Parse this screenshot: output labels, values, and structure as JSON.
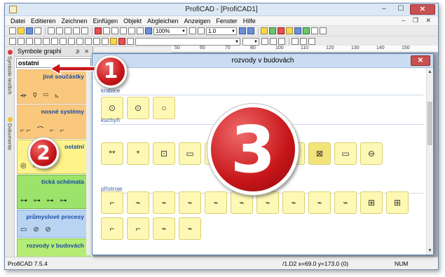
{
  "window": {
    "title": "ProfiCAD - [ProfiCAD1]",
    "controls": {
      "minimize": "–",
      "maximize": "☐",
      "close": "✕"
    }
  },
  "menu": {
    "items": [
      "Datei",
      "Editieren",
      "Zeichnen",
      "Einfügen",
      "Objekt",
      "Abgleichen",
      "Anzeigen",
      "Fenster",
      "Hilfe"
    ],
    "mdi_controls": "– ❐ ✕"
  },
  "toolbar": {
    "zoom_value": "100%",
    "line_width_value": "1.0"
  },
  "ruler": {
    "ticks": [
      "50",
      "60",
      "70",
      "80",
      "100",
      "110",
      "120",
      "130",
      "140",
      "150"
    ]
  },
  "side_tabs": [
    "Symbole textlich",
    "Dokumente"
  ],
  "symbols_panel": {
    "header": "Symbole graphi",
    "pin_controls": "⊅ ✕",
    "selected_category": "ostatní",
    "categories": [
      {
        "name": "jiné součástky",
        "symbols": "⟛ ⊽ ▭ ◺"
      },
      {
        "name": "nosné systémy",
        "symbols": "⌐⌐ ⌒ ⌐ ⌐"
      },
      {
        "name": "ostatní",
        "symbols": "◎ ▭ ⏚"
      },
      {
        "name": "tická schémata",
        "symbols": "⊶ ⊶ ⊶ ⊶"
      },
      {
        "name": "průmyslové procesy",
        "symbols": "▭ ⊘ ⊘"
      },
      {
        "name": "rozvody v budovách",
        "symbols": "⊡ ◌ ◌ ⌐"
      }
    ]
  },
  "dialog": {
    "title": "rozvody v budovách",
    "close": "✕",
    "sections": [
      {
        "label": "krabice",
        "tiles": [
          "⊙",
          "⊙",
          "○"
        ]
      },
      {
        "label": "kuchyň",
        "tiles": [
          "**",
          "*",
          "⊡",
          "▭",
          "",
          "",
          "",
          "",
          "⊠",
          "▭",
          "⊖"
        ]
      },
      {
        "label": "přístroje",
        "tiles": [
          "⌐",
          "⌁",
          "⌁",
          "⌁",
          "⌁",
          "⌁",
          "⌁",
          "⌁",
          "⌁",
          "⌁",
          "⊞",
          "⊞",
          "⌐",
          "⌐",
          "⌁",
          "⌁"
        ]
      }
    ]
  },
  "statusbar": {
    "version": "ProfiCAD 7.5.4",
    "position": "/1.D2   x=69.0  y=173.0 (0)",
    "num": "NUM"
  },
  "badges": [
    "1",
    "2",
    "3"
  ],
  "colors": {
    "badge_red": "#c7161a",
    "tile_yellow": "#fdf8b4",
    "category_label_blue": "#1a4aa5"
  }
}
